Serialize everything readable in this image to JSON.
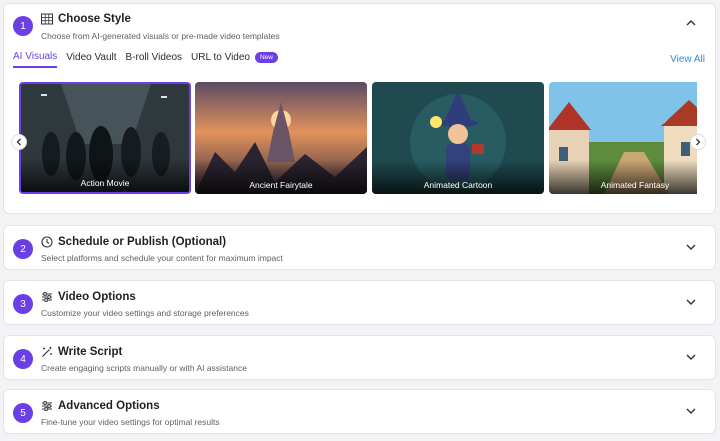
{
  "steps": [
    {
      "number": "1",
      "title": "Choose Style",
      "subtitle": "Choose from AI-generated visuals or pre-made video templates",
      "icon": "grid-icon",
      "expanded": true
    },
    {
      "number": "2",
      "title": "Schedule or Publish  (Optional)",
      "subtitle": "Select platforms and schedule your content for maximum impact",
      "icon": "clock-icon",
      "expanded": false
    },
    {
      "number": "3",
      "title": "Video Options",
      "subtitle": "Customize your video settings and storage preferences",
      "icon": "sliders-icon",
      "expanded": false
    },
    {
      "number": "4",
      "title": "Write Script",
      "subtitle": "Create engaging scripts manually or with AI assistance",
      "icon": "magic-wand-icon",
      "expanded": false
    },
    {
      "number": "5",
      "title": "Advanced Options",
      "subtitle": "Fine-tune your video settings for optimal results",
      "icon": "sliders-icon",
      "expanded": false
    }
  ],
  "style_tabs": [
    {
      "label": "AI Visuals",
      "active": true
    },
    {
      "label": "Video Vault",
      "active": false
    },
    {
      "label": "B-roll Videos",
      "active": false
    },
    {
      "label": "URL to Video",
      "active": false,
      "badge": "New"
    }
  ],
  "view_all_label": "View All",
  "thumbnails": [
    {
      "label": "Action Movie",
      "selected": true
    },
    {
      "label": "Ancient Fairytale",
      "selected": false
    },
    {
      "label": "Animated Cartoon",
      "selected": false
    },
    {
      "label": "Animated Fantasy",
      "selected": false
    }
  ],
  "colors": {
    "accent": "#6b3fe6",
    "link": "#2e8fd9"
  }
}
